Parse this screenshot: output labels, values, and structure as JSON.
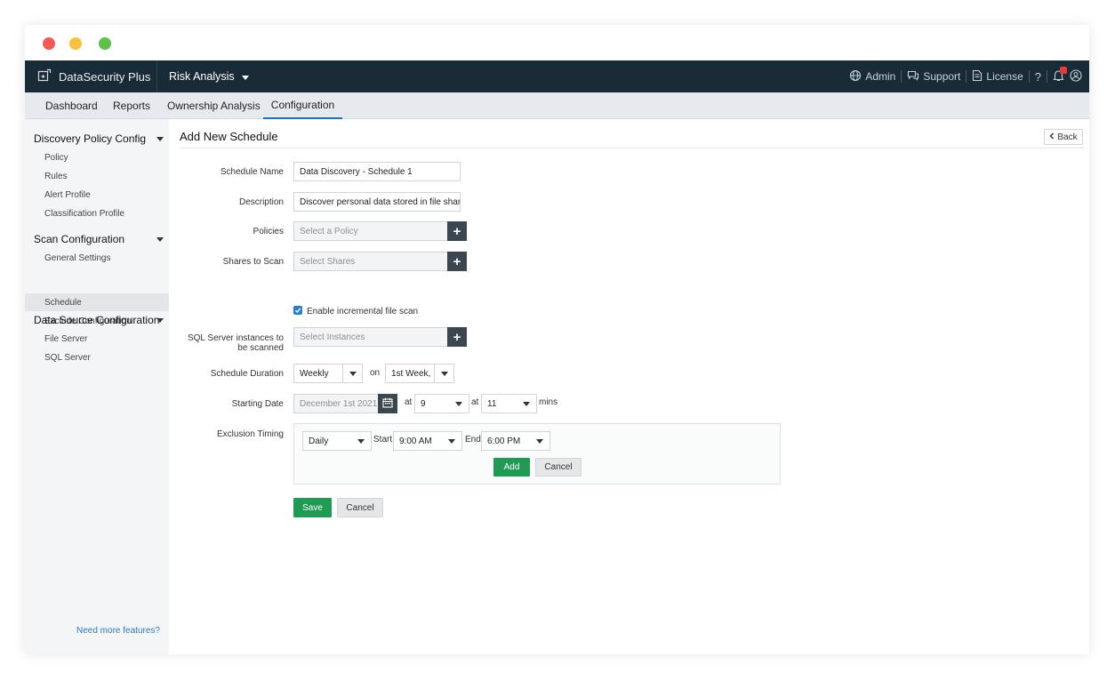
{
  "window_controls": {
    "close_color": "#f25c57",
    "minimize_color": "#f8c03f",
    "maximize_color": "#5cc24c"
  },
  "header": {
    "app_name": "DataSecurity Plus",
    "module": "Risk Analysis",
    "admin": "Admin",
    "support": "Support",
    "license": "License",
    "help": "?"
  },
  "tabs": [
    {
      "label": "Dashboard"
    },
    {
      "label": "Reports"
    },
    {
      "label": "Ownership Analysis"
    },
    {
      "label": "Configuration",
      "active": true
    }
  ],
  "sidebar": {
    "groups": [
      {
        "label": "Discovery Policy Config",
        "items": [
          "Policy",
          "Rules",
          "Alert Profile",
          "Classification Profile"
        ]
      },
      {
        "label": "Scan Configuration",
        "items": [
          "General Settings",
          "Schedule",
          "Exclude Configuration"
        ]
      },
      {
        "label": "Data Source Configuration",
        "items": [
          "File Server",
          "SQL Server"
        ]
      }
    ],
    "active_item": "Schedule",
    "need_more": "Need more features?"
  },
  "page": {
    "title": "Add New Schedule",
    "back": "Back"
  },
  "form": {
    "schedule_name": {
      "label": "Schedule Name",
      "value": "Data Discovery - Schedule 1"
    },
    "description": {
      "label": "Description",
      "value": "Discover personal data stored in file shares"
    },
    "policies": {
      "label": "Policies",
      "placeholder": "Select a Policy"
    },
    "shares": {
      "label": "Shares to Scan",
      "placeholder": "Select Shares"
    },
    "incremental": {
      "label": "Enable incremental file scan",
      "checked": true
    },
    "sql_instances": {
      "label_line1": "SQL Server instances to",
      "label_line2": "be scanned",
      "placeholder": "Select Instances"
    },
    "duration": {
      "label": "Schedule Duration",
      "value": "Weekly",
      "on": "on",
      "week": "1st Week,"
    },
    "starting_date": {
      "label": "Starting Date",
      "value": "December 1st 2021",
      "at1": "at",
      "hour": "9",
      "at2": "at",
      "minute": "11",
      "mins": "mins"
    },
    "exclusion": {
      "label": "Exclusion Timing",
      "frequency": "Daily",
      "start_label": "Start",
      "start": "9:00 AM",
      "end_label": "End",
      "end": "6:00 PM",
      "add": "Add",
      "cancel": "Cancel"
    },
    "save": "Save",
    "cancel": "Cancel"
  },
  "colors": {
    "topbar": "#1a2b38",
    "accent_blue": "#1e6fb5",
    "button_green": "#219a56",
    "link": "#2b7bb9"
  }
}
